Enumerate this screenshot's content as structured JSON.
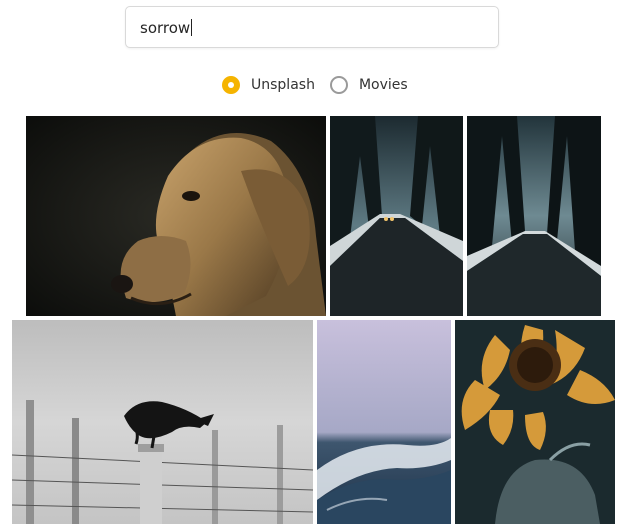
{
  "search": {
    "value": "sorrow",
    "placeholder": ""
  },
  "source_options": [
    {
      "label": "Unsplash",
      "selected": true
    },
    {
      "label": "Movies",
      "selected": false
    }
  ],
  "colors": {
    "accent": "#f5b400",
    "radio_unselected": "#9a9a9a"
  },
  "results": [
    {
      "subject": "golden retriever dog in dark"
    },
    {
      "subject": "foggy forest road with car lights"
    },
    {
      "subject": "dark forest road at dusk"
    },
    {
      "subject": "crow on wooden fence post"
    },
    {
      "subject": "misty ocean shore"
    },
    {
      "subject": "wilted sunflower"
    }
  ]
}
